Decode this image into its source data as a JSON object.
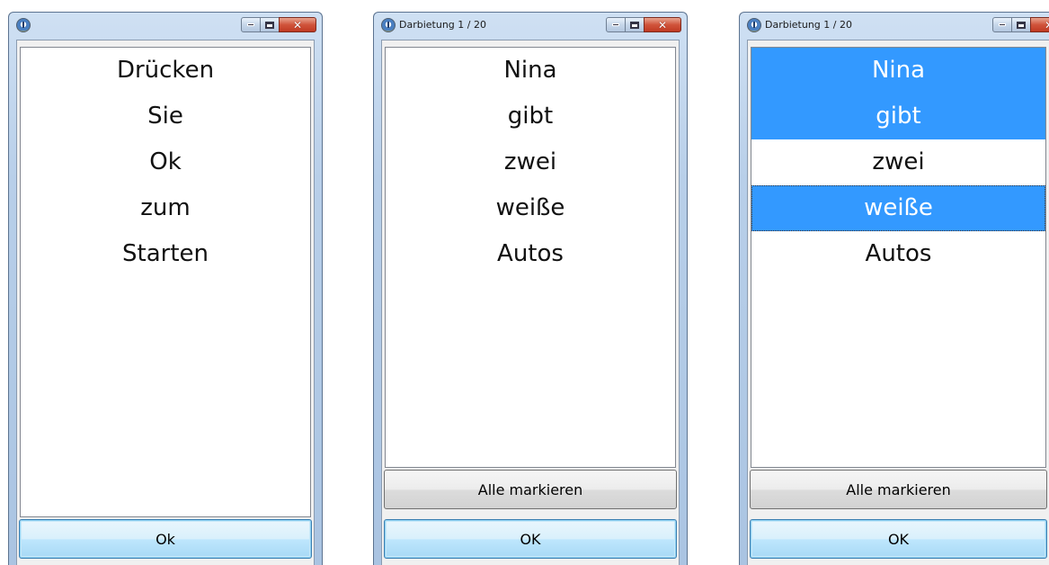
{
  "windows": [
    {
      "title": "",
      "words": [
        "Drücken",
        "Sie",
        "Ok",
        "zum",
        "Starten"
      ],
      "ok_label": "Ok"
    },
    {
      "title": "Darbietung 1 / 20",
      "words": [
        "Nina",
        "gibt",
        "zwei",
        "weiße",
        "Autos"
      ],
      "select_all_label": "Alle markieren",
      "ok_label": "OK"
    },
    {
      "title": "Darbietung 1 / 20",
      "words": [
        "Nina",
        "gibt",
        "zwei",
        "weiße",
        "Autos"
      ],
      "selected_words": [
        "Nina",
        "gibt",
        "weiße"
      ],
      "select_all_label": "Alle markieren",
      "ok_label": "OK"
    }
  ],
  "colors": {
    "selection": "#3399ff",
    "close_button": "#c03a23"
  },
  "icons": [
    "app-info-icon",
    "minimize-icon",
    "maximize-icon",
    "close-icon"
  ]
}
